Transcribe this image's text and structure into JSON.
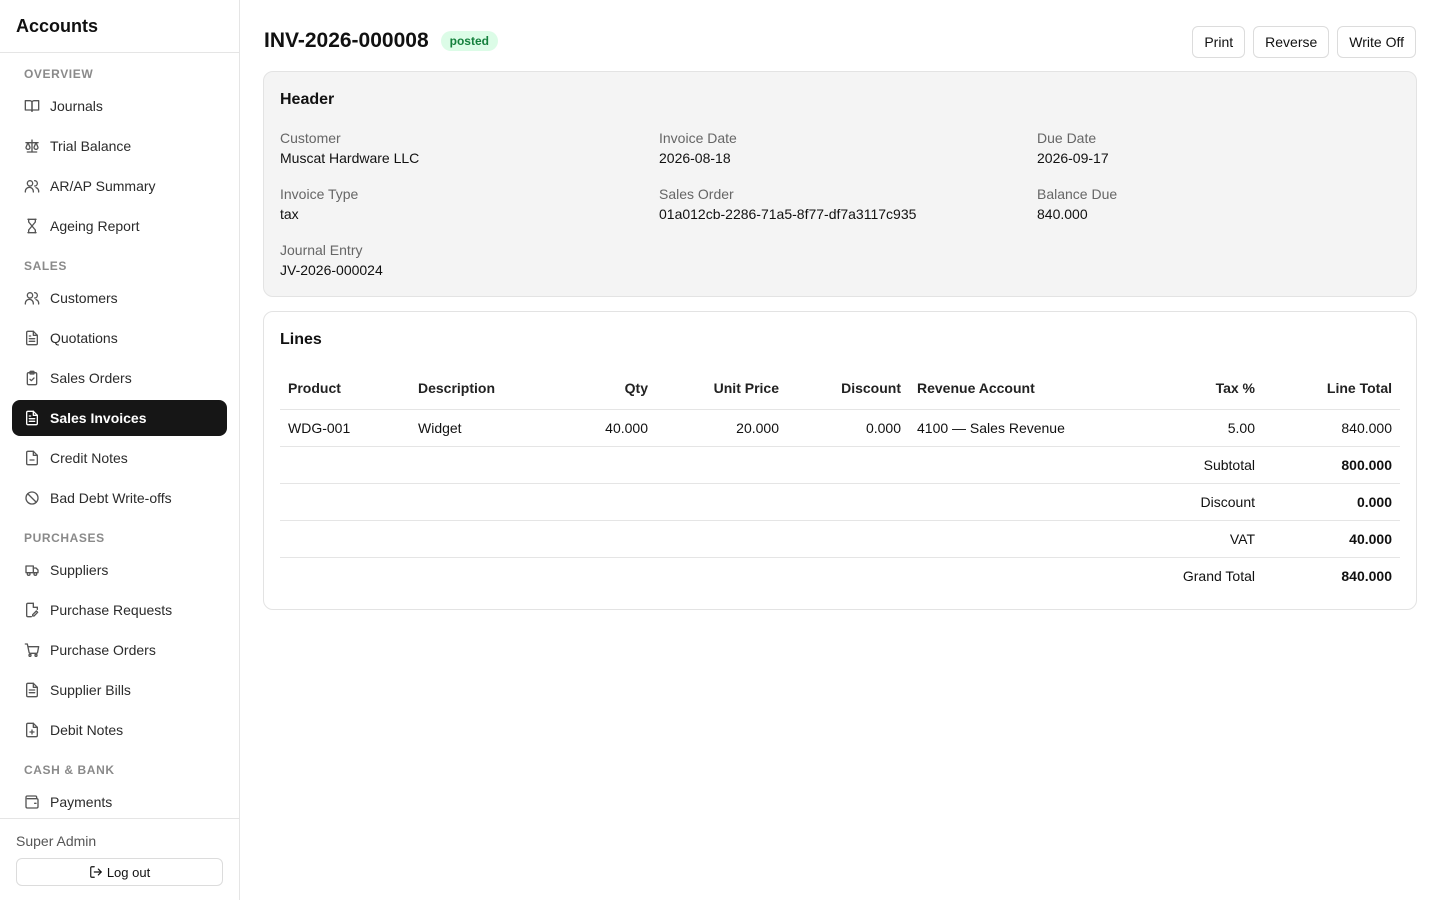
{
  "app": {
    "title": "Accounts"
  },
  "sidebar": {
    "sections": [
      {
        "label": "OVERVIEW",
        "items": [
          {
            "label": "Journals",
            "icon": "book-icon"
          },
          {
            "label": "Trial Balance",
            "icon": "scale-icon"
          },
          {
            "label": "AR/AP Summary",
            "icon": "users-icon"
          },
          {
            "label": "Ageing Report",
            "icon": "hourglass-icon"
          }
        ]
      },
      {
        "label": "SALES",
        "items": [
          {
            "label": "Customers",
            "icon": "users-icon"
          },
          {
            "label": "Quotations",
            "icon": "file-text-icon"
          },
          {
            "label": "Sales Orders",
            "icon": "clipboard-check-icon"
          },
          {
            "label": "Sales Invoices",
            "icon": "file-text-icon",
            "active": true
          },
          {
            "label": "Credit Notes",
            "icon": "file-minus-icon"
          },
          {
            "label": "Bad Debt Write-offs",
            "icon": "ban-icon"
          }
        ]
      },
      {
        "label": "PURCHASES",
        "items": [
          {
            "label": "Suppliers",
            "icon": "truck-icon"
          },
          {
            "label": "Purchase Requests",
            "icon": "file-edit-icon"
          },
          {
            "label": "Purchase Orders",
            "icon": "cart-icon"
          },
          {
            "label": "Supplier Bills",
            "icon": "receipt-icon"
          },
          {
            "label": "Debit Notes",
            "icon": "file-plus-icon"
          }
        ]
      },
      {
        "label": "CASH & BANK",
        "items": [
          {
            "label": "Payments",
            "icon": "wallet-icon"
          }
        ]
      }
    ],
    "user": "Super Admin",
    "logout_label": "Log out"
  },
  "invoice": {
    "number": "INV-2026-000008",
    "status": "posted",
    "status_color": "#15803d",
    "actions": {
      "print": "Print",
      "reverse": "Reverse",
      "write_off": "Write Off"
    }
  },
  "header": {
    "title": "Header",
    "fields": {
      "customer": {
        "label": "Customer",
        "value": "Muscat Hardware LLC"
      },
      "invoice_date": {
        "label": "Invoice Date",
        "value": "2026-08-18"
      },
      "due_date": {
        "label": "Due Date",
        "value": "2026-09-17"
      },
      "invoice_type": {
        "label": "Invoice Type",
        "value": "tax"
      },
      "sales_order": {
        "label": "Sales Order",
        "value": "01a012cb-2286-71a5-8f77-df7a3117c935"
      },
      "balance_due": {
        "label": "Balance Due",
        "value": "840.000"
      },
      "journal_entry": {
        "label": "Journal Entry",
        "value": "JV-2026-000024"
      }
    }
  },
  "lines": {
    "title": "Lines",
    "columns": [
      "Product",
      "Description",
      "Qty",
      "Unit Price",
      "Discount",
      "Revenue Account",
      "Tax %",
      "Line Total"
    ],
    "rows": [
      {
        "product": "WDG-001",
        "description": "Widget",
        "qty": "40.000",
        "unit_price": "20.000",
        "discount": "0.000",
        "revenue_account": "4100 — Sales Revenue",
        "tax": "5.00",
        "line_total": "840.000"
      }
    ],
    "totals": [
      {
        "label": "Subtotal",
        "value": "800.000"
      },
      {
        "label": "Discount",
        "value": "0.000"
      },
      {
        "label": "VAT",
        "value": "40.000"
      },
      {
        "label": "Grand Total",
        "value": "840.000"
      }
    ]
  }
}
